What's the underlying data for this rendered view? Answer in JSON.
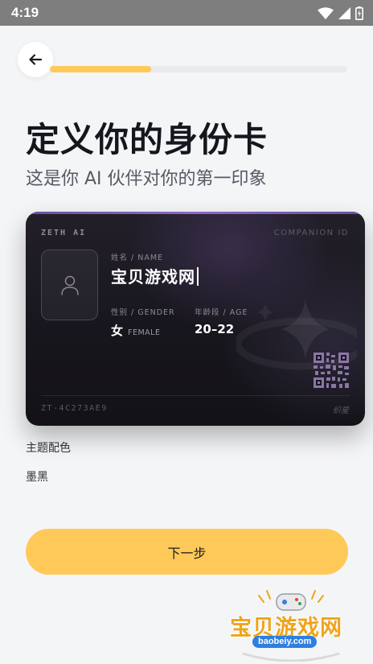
{
  "status_bar": {
    "time": "4:19",
    "icons": [
      "wifi-icon",
      "signal-icon",
      "battery-icon"
    ]
  },
  "header": {
    "back_icon": "arrow-left-icon",
    "progress": 0.34
  },
  "title": "定义你的身份卡",
  "subtitle": "这是你 AI 伙伴对你的第一印象",
  "card": {
    "brand": "ZETH AI",
    "id_label": "COMPANION ID",
    "avatar_icon": "person-icon",
    "name_label": "姓名 / NAME",
    "name_value": "宝贝游戏网",
    "gender_label": "性别 / GENDER",
    "gender_value": "女",
    "gender_value_en": "FEMALE",
    "age_label": "年龄段 / AGE",
    "age_value": "20–22",
    "code": "ZT-4C273AE9",
    "signature": "织星",
    "decor_icon": "sparkle-star-icon",
    "qr_icon": "qr-code-icon"
  },
  "theme": {
    "label": "主题配色",
    "value": "墨黑"
  },
  "next_button_label": "下一步",
  "watermark": {
    "title": "宝贝游戏网",
    "url": "baobeiy.com"
  },
  "colors": {
    "accent": "#ffc95a",
    "card_bg": "#18161d",
    "background": "#f4f5f7"
  }
}
